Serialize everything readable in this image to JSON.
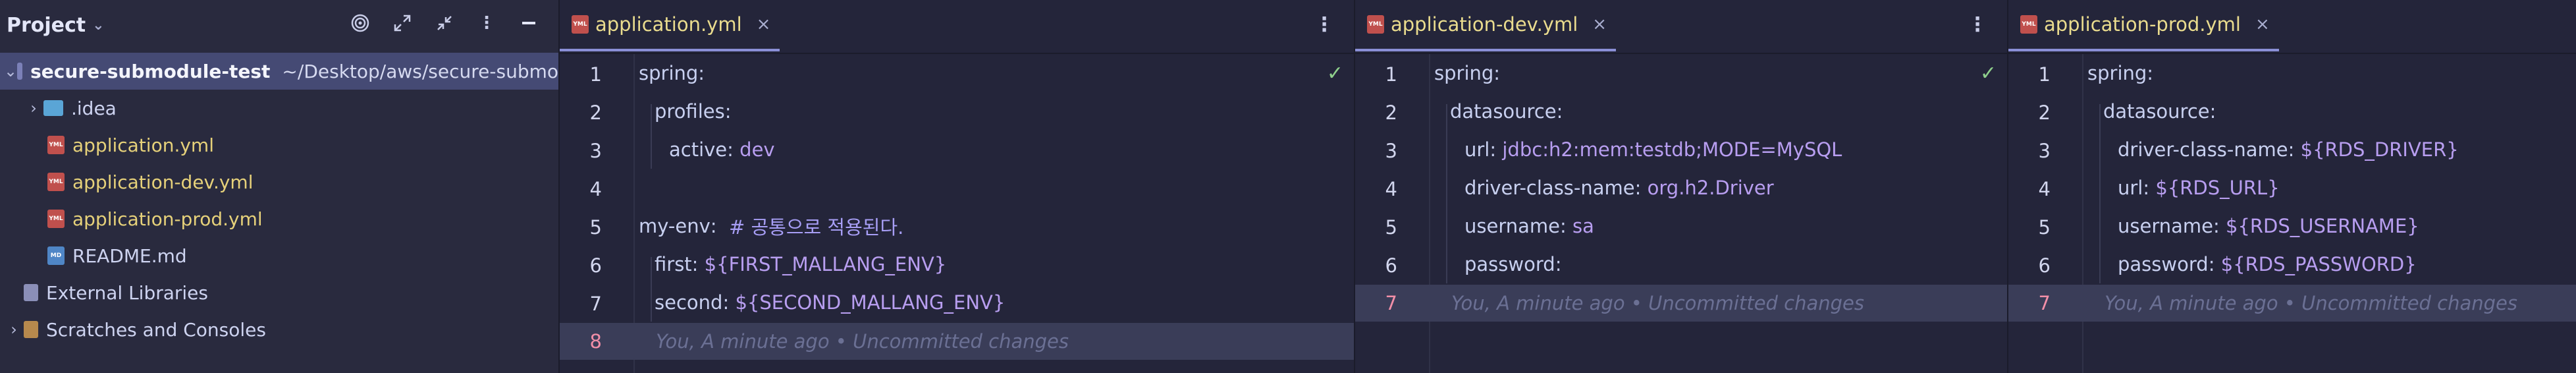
{
  "project_panel": {
    "title": "Project",
    "root": {
      "name": "secure-submodule-test",
      "path": "~/Desktop/aws/secure-submo"
    },
    "items": [
      {
        "label": ".idea"
      },
      {
        "label": "application.yml"
      },
      {
        "label": "application-dev.yml"
      },
      {
        "label": "application-prod.yml"
      },
      {
        "label": "README.md"
      },
      {
        "label": "External Libraries"
      },
      {
        "label": "Scratches and Consoles"
      }
    ],
    "file_icon_text": {
      "yml": "YML",
      "md": "MD"
    }
  },
  "editors": [
    {
      "tab": "application.yml",
      "lines": [
        {
          "n": "1",
          "key": "spring",
          "sep": ":",
          "val": ""
        },
        {
          "n": "2",
          "key": "profiles",
          "sep": ":",
          "val": ""
        },
        {
          "n": "3",
          "key": "active",
          "sep": ":",
          "val": "dev"
        },
        {
          "n": "4",
          "key": "",
          "sep": "",
          "val": ""
        },
        {
          "n": "5",
          "key": "my-env",
          "sep": ":",
          "val": "",
          "comment": "# 공통으로 적용된다."
        },
        {
          "n": "6",
          "key": "first",
          "sep": ":",
          "val": "${FIRST_MALLANG_ENV}"
        },
        {
          "n": "7",
          "key": "second",
          "sep": ":",
          "val": "${SECOND_MALLANG_ENV}"
        },
        {
          "n": "8",
          "blame": "You, A minute ago • Uncommitted changes"
        }
      ]
    },
    {
      "tab": "application-dev.yml",
      "lines": [
        {
          "n": "1",
          "key": "spring",
          "sep": ":",
          "val": ""
        },
        {
          "n": "2",
          "key": "datasource",
          "sep": ":",
          "val": ""
        },
        {
          "n": "3",
          "key": "url",
          "sep": ":",
          "val": "jdbc:h2:mem:testdb;MODE=MySQL"
        },
        {
          "n": "4",
          "key": "driver-class-name",
          "sep": ":",
          "val": "org.h2.Driver"
        },
        {
          "n": "5",
          "key": "username",
          "sep": ":",
          "val": "sa"
        },
        {
          "n": "6",
          "key": "password",
          "sep": ":",
          "val": ""
        },
        {
          "n": "7",
          "blame": "You, A minute ago • Uncommitted changes"
        }
      ]
    },
    {
      "tab": "application-prod.yml",
      "lines": [
        {
          "n": "1",
          "key": "spring",
          "sep": ":",
          "val": ""
        },
        {
          "n": "2",
          "key": "datasource",
          "sep": ":",
          "val": ""
        },
        {
          "n": "3",
          "key": "driver-class-name",
          "sep": ":",
          "val": "${RDS_DRIVER}"
        },
        {
          "n": "4",
          "key": "url",
          "sep": ":",
          "val": "${RDS_URL}"
        },
        {
          "n": "5",
          "key": "username",
          "sep": ":",
          "val": "${RDS_USERNAME}"
        },
        {
          "n": "6",
          "key": "password",
          "sep": ":",
          "val": "${RDS_PASSWORD}"
        },
        {
          "n": "7",
          "blame": "You, A minute ago • Uncommitted changes"
        }
      ]
    }
  ],
  "colors": {
    "accent": "#8a8fd6",
    "yaml_value": "#b89ef0",
    "modified_file": "#e6d17a",
    "current_line_number": "#f28fa8"
  }
}
